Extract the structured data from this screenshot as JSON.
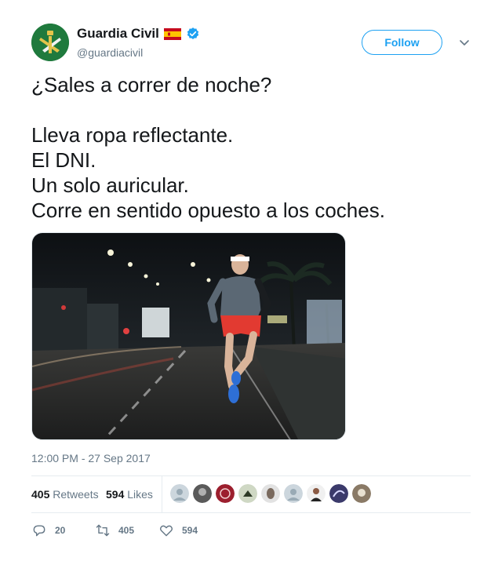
{
  "tweet": {
    "author": {
      "name": "Guardia Civil",
      "handle": "@guardiacivil",
      "flag_icon": "spain-flag-icon",
      "verified_icon": "verified-badge-icon"
    },
    "follow_label": "Follow",
    "text": "¿Sales a correr de noche?\n\nLleva ropa reflectante.\nEl DNI.\nUn solo auricular.\nCorre en sentido opuesto a los coches.",
    "timestamp": "12:00 PM - 27 Sep 2017",
    "stats": {
      "retweets_count": "405",
      "retweets_label": "Retweets",
      "likes_count": "594",
      "likes_label": "Likes"
    },
    "actions": {
      "reply_count": "20",
      "retweet_count": "405",
      "like_count": "594"
    }
  },
  "colors": {
    "accent": "#1da1f2",
    "muted": "#657786",
    "text": "#14171a",
    "avatar_green": "#1f7a3d"
  }
}
